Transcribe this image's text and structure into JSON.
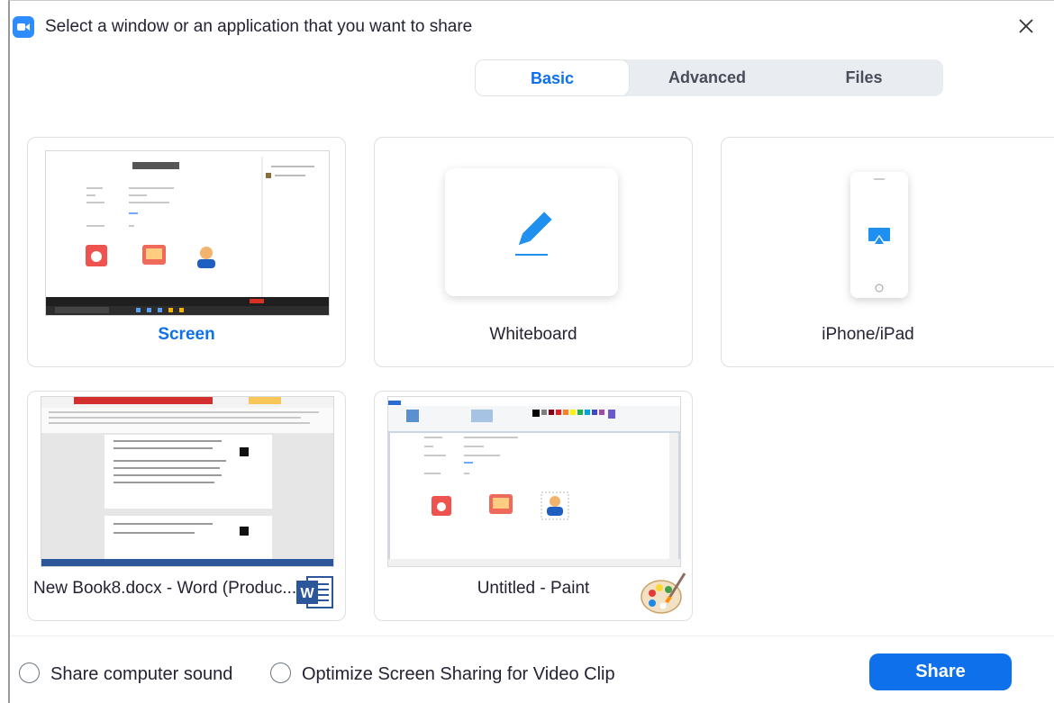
{
  "window": {
    "title": "Select a window or an application that you want to share",
    "app_icon": "zoom-camera-icon",
    "close_icon": "close-icon"
  },
  "tabs": [
    {
      "label": "Basic",
      "active": true
    },
    {
      "label": "Advanced",
      "active": false
    },
    {
      "label": "Files",
      "active": false
    }
  ],
  "tiles": [
    {
      "label": "Screen",
      "selected": true,
      "thumbnail": "desktop-screenshot"
    },
    {
      "label": "Whiteboard",
      "selected": false,
      "icon": "pen-icon"
    },
    {
      "label": "iPhone/iPad",
      "selected": false,
      "icon": "airplay-icon"
    },
    {
      "label": "New Book8.docx - Word (Produc...",
      "selected": false,
      "thumbnail": "word-document-screenshot",
      "app_icon": "word-icon"
    },
    {
      "label": "Untitled - Paint",
      "selected": false,
      "thumbnail": "paint-screenshot",
      "app_icon": "paint-palette-icon"
    }
  ],
  "options": {
    "share_sound_label": "Share computer sound",
    "share_sound_checked": false,
    "optimize_video_label": "Optimize Screen Sharing for Video Clip",
    "optimize_video_checked": false
  },
  "actions": {
    "share_label": "Share"
  },
  "colors": {
    "accent": "#0e71eb",
    "tab_bg": "#e9edf2",
    "word_blue": "#2b579a",
    "word_ribbon_red": "#d32f2f"
  }
}
